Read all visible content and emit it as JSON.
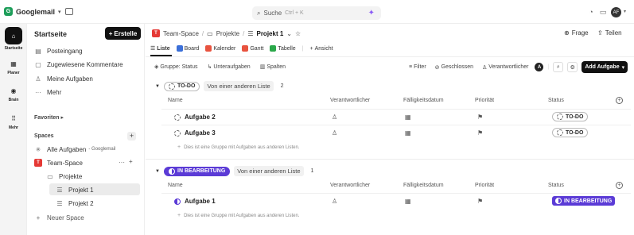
{
  "topbar": {
    "workspace": "Googlemail",
    "workspace_initial": "G",
    "search_label": "Suche",
    "search_shortcut": "Ctrl + K",
    "avatar": "AF"
  },
  "rail": {
    "items": [
      {
        "label": "Startseite",
        "icon": "home-icon"
      },
      {
        "label": "Planer",
        "icon": "calendar-icon"
      },
      {
        "label": "Brain",
        "icon": "brain-icon"
      },
      {
        "label": "Mehr",
        "icon": "grid-icon"
      }
    ]
  },
  "sidebar": {
    "title": "Startseite",
    "create_label": "Erstelle",
    "nav": [
      {
        "label": "Posteingang",
        "icon": "inbox-icon"
      },
      {
        "label": "Zugewiesene Kommentare",
        "icon": "comment-icon"
      },
      {
        "label": "Meine Aufgaben",
        "icon": "user-icon"
      },
      {
        "label": "Mehr",
        "icon": "dots-icon"
      }
    ],
    "favorites_label": "Favoriten",
    "spaces_label": "Spaces",
    "all_tasks_label": "Alle Aufgaben",
    "all_tasks_suffix": "- Googlemail",
    "space_name": "Team-Space",
    "space_initial": "T",
    "folder_name": "Projekte",
    "lists": [
      "Projekt 1",
      "Projekt 2"
    ],
    "new_space_label": "Neuer Space"
  },
  "header": {
    "breadcrumb": [
      "Team-Space",
      "Projekte",
      "Projekt 1"
    ],
    "space_initial": "T",
    "ask_label": "Frage",
    "share_label": "Teilen"
  },
  "views": [
    {
      "label": "Liste",
      "color": "#444444"
    },
    {
      "label": "Board",
      "color": "#3b6fd8"
    },
    {
      "label": "Kalender",
      "color": "#e8533f"
    },
    {
      "label": "Gantt",
      "color": "#e8533f"
    },
    {
      "label": "Tabelle",
      "color": "#2ba84a"
    },
    {
      "label": "Ansicht",
      "color": ""
    }
  ],
  "toolbar": {
    "group": "Gruppe: Status",
    "subtasks": "Unteraufgaben",
    "columns": "Spalten",
    "filter": "Filter",
    "closed": "Geschlossen",
    "assignee": "Verantwortlicher",
    "assignee_initial": "A",
    "add_task": "Add Aufgabe"
  },
  "columns": {
    "name": "Name",
    "assignee": "Verantwortlicher",
    "due": "Fälligkeitsdatum",
    "priority": "Priorität",
    "status": "Status"
  },
  "groups": [
    {
      "status": "TO-DO",
      "other_list": "Von einer anderen Liste",
      "count": "2",
      "tasks": [
        {
          "name": "Aufgabe 2",
          "status": "TO-DO"
        },
        {
          "name": "Aufgabe 3",
          "status": "TO-DO"
        }
      ],
      "note": "Dies ist eine Gruppe mit Aufgaben aus anderen Listen."
    },
    {
      "status": "IN BEARBEITUNG",
      "other_list": "Von einer anderen Liste",
      "count": "1",
      "tasks": [
        {
          "name": "Aufgabe 1",
          "status": "IN BEARBEITUNG"
        }
      ],
      "note": "Dies ist eine Gruppe mit Aufgaben aus anderen Listen."
    }
  ],
  "colors": {
    "accent": "#5b3bd6",
    "space_red": "#e53935",
    "workspace_green": "#1e9e5a"
  }
}
